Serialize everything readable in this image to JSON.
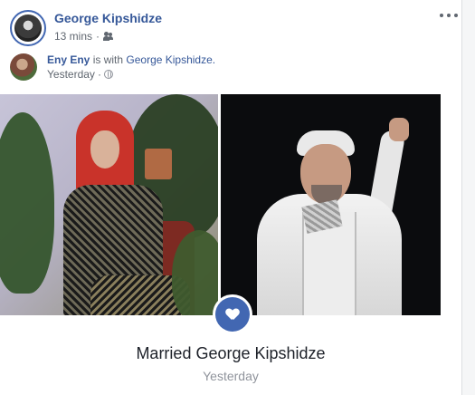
{
  "post": {
    "author": "George Kipshidze",
    "time": "13 mins",
    "separator": "·"
  },
  "shared": {
    "person": "Eny Eny",
    "connector": "is with",
    "tagged": "George Kipshidze.",
    "time": "Yesterday",
    "separator": "·"
  },
  "event": {
    "title": "Married George Kipshidze",
    "date": "Yesterday"
  },
  "icons": {
    "audience": "friends-icon",
    "privacy": "globe-icon",
    "event": "heart-icon",
    "menu": "more-options-icon"
  },
  "colors": {
    "link": "#365899",
    "accent": "#4267b2",
    "muted": "#606770"
  }
}
